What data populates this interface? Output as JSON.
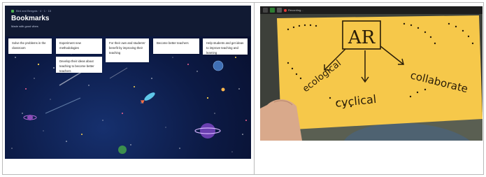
{
  "bookmarks_board": {
    "breadcrumb": "Bird and Bengals · 4 · 1 · 15",
    "title": "Bookmarks",
    "subtitle": "Made with good vibes",
    "cards": [
      "Solve the problems in the classroom",
      "Experiment new methodologies",
      "Develop their ideas about teaching to become better teachers",
      "For their own and students' benefit by improving their teaching",
      "Become better teachers",
      "Help students and get ideas to improve teaching and learning"
    ]
  },
  "video_call": {
    "recording_label": "Recording...",
    "drawing": {
      "center": "AR",
      "left_branch": "ecological",
      "bottom_branch": "cyclical",
      "right_branch": "collaborate"
    },
    "colors": {
      "paper": "#f6c84a",
      "ink": "#2a1d08",
      "wall": "#5a5f52"
    }
  }
}
